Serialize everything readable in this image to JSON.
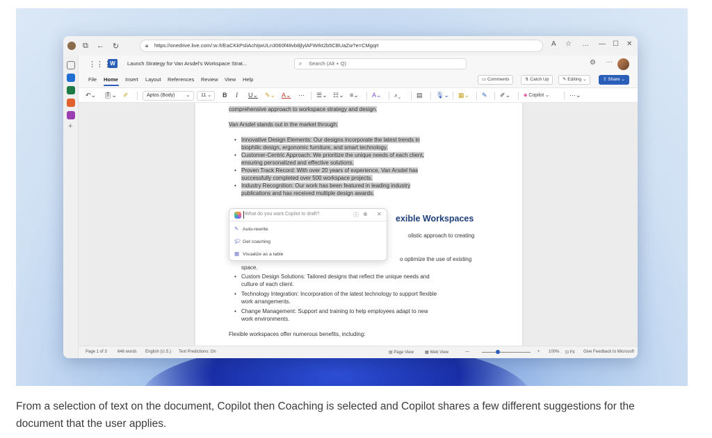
{
  "browser": {
    "url": "https://onedrive.live.com/:w:/t/EaCKkPsliAchIjwULn3060f48vb8jlylAFWrkt2b5CBUaZw?e=CMgqrI",
    "controls": [
      "…",
      "—",
      "☐",
      "✕"
    ]
  },
  "app": {
    "doc_title": "Launch Strategy for Van Arsdel's Workspace Strat...",
    "search_placeholder": "Search (Alt + Q)"
  },
  "menu": {
    "items": [
      "File",
      "Home",
      "Insert",
      "Layout",
      "References",
      "Review",
      "View",
      "Help"
    ],
    "active": "Home",
    "comments_label": "Comments",
    "catchup_label": "Catch Up",
    "editing_label": "Editing",
    "share_label": "Share"
  },
  "ribbon": {
    "font_name": "Aptos (Body)",
    "font_size": "11",
    "copilot_label": "Copilot"
  },
  "document": {
    "line_top": "comprehensive approach to workspace strategy and design.",
    "intro": "Van Arsdel stands out in the market through:",
    "bullets_selected": [
      [
        "Innovative Design Elements: Our designs incorporate the latest trends in",
        "biophilic design, ergonomic furniture, and smart technology."
      ],
      [
        "Customer-Centric Approach: We prioritize the unique needs of each client,",
        "ensuring personalized and effective solutions."
      ],
      [
        "Proven Track Record: With over 20 years of experience, Van Arsdel has",
        "successfully completed over 500 workspace projects."
      ],
      [
        "Industry Recognition: Our work has been featured in leading industry",
        "publications and has received multiple design awards."
      ]
    ],
    "heading_fragment": "exible Workspaces",
    "partial_line_1": "olistic approach to creating",
    "partial_line_2": "o optimize the use of existing",
    "space_line": "space.",
    "bullets_after": [
      [
        "Custom Design Solutions: Tailored designs that reflect the unique needs and",
        "culture of each client."
      ],
      [
        "Technology Integration: Incorporation of the latest technology to support flexible",
        "work arrangements."
      ],
      [
        "Change Management: Support and training to help employees adapt to new",
        "work environments."
      ]
    ],
    "closing": "Flexible workspaces offer numerous benefits, including:"
  },
  "copilot": {
    "placeholder": "What do you want Copilot to draft?",
    "suggestions": [
      {
        "icon": "auto-rewrite-icon",
        "label": "Auto-rewrite"
      },
      {
        "icon": "coaching-icon",
        "label": "Get coaching"
      },
      {
        "icon": "table-icon",
        "label": "Visualize as a table"
      }
    ]
  },
  "status": {
    "page": "Page 1 of 3",
    "words": "646 words",
    "language": "English (U.S.)",
    "predictions": "Text Predictions: On",
    "page_view": "Page View",
    "web_view": "Web View",
    "zoom": "100%",
    "fit": "Fit",
    "feedback": "Give Feedback to Microsoft"
  },
  "caption": "From a selection of text on the document, Copilot then Coaching is selected and Copilot shares a few different suggestions for the document that the user applies."
}
